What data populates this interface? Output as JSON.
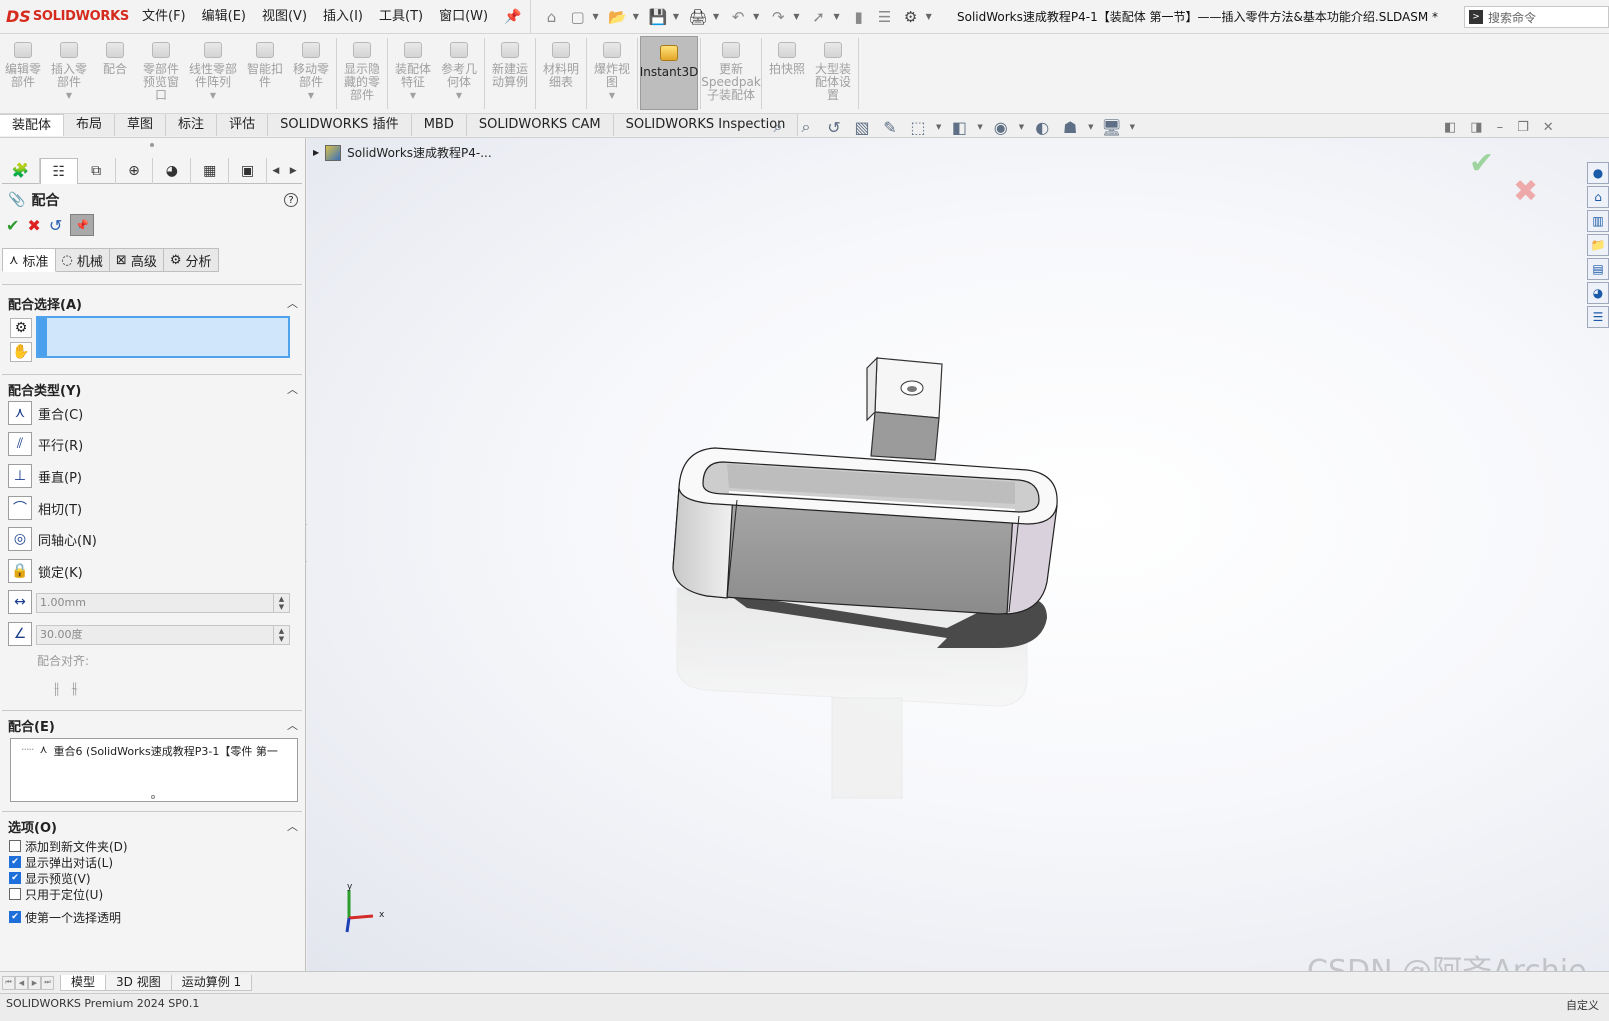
{
  "app": {
    "brand_mark": "DS",
    "brand_name": "SOLIDWORKS"
  },
  "menu": [
    "文件(F)",
    "编辑(E)",
    "视图(V)",
    "插入(I)",
    "工具(T)",
    "窗口(W)"
  ],
  "title": "SolidWorks速成教程P4-1【装配体  第一节】——插入零件方法&基本功能介绍.SLDASM *",
  "search": {
    "placeholder": "搜索命令"
  },
  "ribbon": {
    "buttons": [
      "编辑零部件",
      "插入零部件",
      "配合",
      "零部件预览窗口",
      "线性零部件阵列",
      "智能扣件",
      "移动零部件",
      "显示隐藏的零部件",
      "装配体特征",
      "参考几何体",
      "新建运动算例",
      "材料明细表",
      "爆炸视图",
      "Instant3D",
      "更新Speedpak子装配体",
      "拍快照",
      "大型装配体设置"
    ],
    "active": "Instant3D"
  },
  "tabs": [
    "装配体",
    "布局",
    "草图",
    "标注",
    "评估",
    "SOLIDWORKS 插件",
    "MBD",
    "SOLIDWORKS CAM",
    "SOLIDWORKS Inspection"
  ],
  "pm": {
    "title": "配合",
    "help": "?",
    "subtabs": [
      "标准",
      "机械",
      "高级",
      "分析"
    ],
    "sections": {
      "selection": "配合选择(A)",
      "types": "配合类型(Y)",
      "mates": "配合(E)",
      "options": "选项(O)"
    },
    "mate_types": [
      "重合(C)",
      "平行(R)",
      "垂直(P)",
      "相切(T)",
      "同轴心(N)",
      "锁定(K)"
    ],
    "distance": "1.00mm",
    "angle": "30.00度",
    "mate_align_label": "配合对齐:",
    "mate_list_item": "重合6 (SolidWorks速成教程P3-1【零件  第一",
    "options": [
      {
        "label": "添加到新文件夹(D)",
        "checked": false
      },
      {
        "label": "显示弹出对话(L)",
        "checked": true
      },
      {
        "label": "显示预览(V)",
        "checked": true
      },
      {
        "label": "只用于定位(U)",
        "checked": false
      },
      {
        "label": "使第一个选择透明",
        "checked": true
      }
    ]
  },
  "viewport": {
    "tree_item": "SolidWorks速成教程P4-...",
    "triad": {
      "x": "x",
      "y": "y"
    }
  },
  "watermark": "CSDN @阿齐Archie",
  "bottom_tabs": [
    "模型",
    "3D 视图",
    "运动算例 1"
  ],
  "status": {
    "left": "SOLIDWORKS Premium 2024 SP0.1",
    "right": "自定义"
  }
}
